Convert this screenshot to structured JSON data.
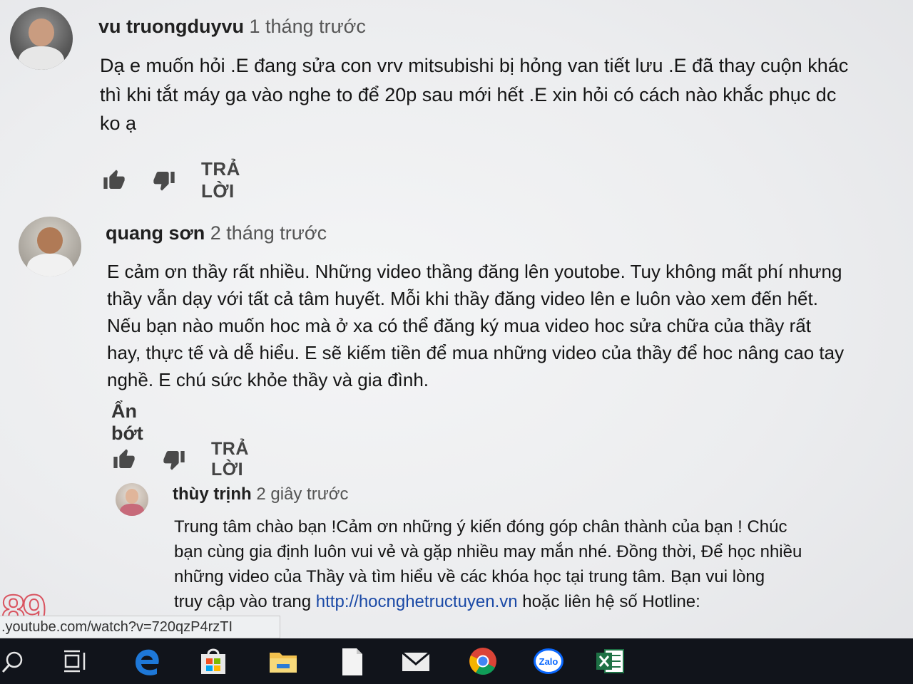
{
  "comments": [
    {
      "author": "vu truongduyvu",
      "time": "1 tháng trước",
      "lines": [
        "Dạ e muốn hỏi .E đang sửa con vrv mitsubishi bị hỏng van tiết lưu .E đã thay cuộn khác",
        "thì khi tắt máy ga vào nghe to để 20p sau mới hết .E xin hỏi có cách nào khắc phục dc",
        "ko ạ"
      ],
      "reply_label": "TRẢ LỜI"
    },
    {
      "author": "quang sơn",
      "time": "2 tháng trước",
      "lines": [
        "E cảm ơn thầy rất nhiều. Những video thầng đăng lên youtobe. Tuy không mất phí nhưng",
        "thầy vẫn dạy với tất cả tâm huyết. Mỗi khi thầy đăng video lên e luôn vào xem đến hết.",
        "Nếu bạn nào muốn hoc mà ở xa có thể đăng ký mua video hoc sửa chữa của thầy rất",
        "hay, thực tế và dễ hiểu. E sẽ kiếm tiền để mua những video của thầy để hoc nâng cao tay",
        "nghề. E chú sức khỏe thầy và gia đình."
      ],
      "show_less": "Ẩn bớt",
      "reply_label": "TRẢ LỜI"
    }
  ],
  "reply": {
    "author": "thùy trịnh",
    "time": "2 giây trước",
    "lines": [
      "Trung tâm chào bạn !Cảm ơn những ý kiến đóng góp chân thành của bạn ! Chúc",
      "bạn cùng gia định luôn vui vẻ và gặp nhiều may mắn nhé. Đồng thời, Để học nhiều",
      "những video của Thầy và tìm hiểu về các khóa học tại trung tâm.  Bạn vui lòng"
    ],
    "last_line_prefix": "truy cập vào trang ",
    "link": "http://hocnghetructuyen.vn",
    "last_line_suffix": " hoặc liên hệ số Hotline:"
  },
  "status_url": ".youtube.com/watch?v=720qzP4rzTI",
  "watermark": "89",
  "taskbar": {
    "icons": [
      "search-icon",
      "task-view-icon",
      "edge-icon",
      "store-icon",
      "file-explorer-icon",
      "document-icon",
      "mail-icon",
      "chrome-icon",
      "zalo-icon",
      "excel-icon"
    ],
    "zalo_label": "Zalo"
  },
  "colors": {
    "link": "#1a49a6",
    "taskbar": "#11141b",
    "edge": "#1e78d8",
    "chrome_red": "#db4437",
    "chrome_yellow": "#f4b400",
    "chrome_green": "#0f9d58",
    "excel": "#1e7145",
    "zalo": "#0a68ff"
  }
}
